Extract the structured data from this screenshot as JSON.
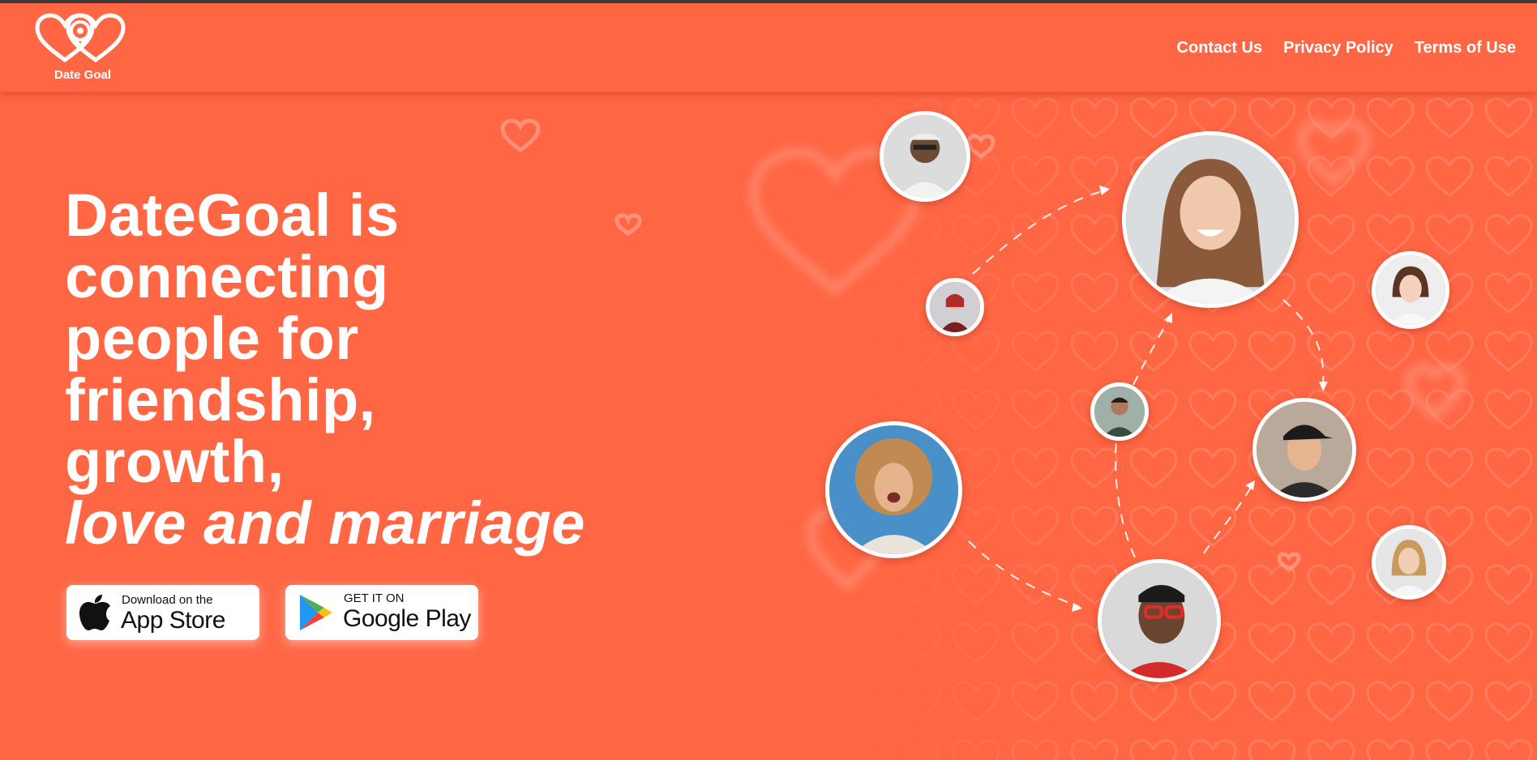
{
  "brand": {
    "name": "Date Goal",
    "accent_color": "#ff6644"
  },
  "nav": {
    "items": [
      {
        "label": "Contact Us"
      },
      {
        "label": "Privacy Policy"
      },
      {
        "label": "Terms of Use"
      }
    ]
  },
  "hero": {
    "lines": [
      "DateGoal is",
      "connecting",
      "people for",
      "friendship,",
      "growth,"
    ],
    "italic_line": "love and marriage"
  },
  "app_store": {
    "small": "Download on the",
    "big": "App Store",
    "icon": "apple-icon"
  },
  "google_play": {
    "small": "GET IT ON",
    "big": "Google Play",
    "icon": "google-play-icon"
  },
  "avatars": [
    {
      "name": "avatar-man-glasses"
    },
    {
      "name": "avatar-woman-red-scarf"
    },
    {
      "name": "avatar-woman-smiling-large"
    },
    {
      "name": "avatar-woman-hand-chin"
    },
    {
      "name": "avatar-man-small"
    },
    {
      "name": "avatar-man-cap"
    },
    {
      "name": "avatar-woman-curly-hair"
    },
    {
      "name": "avatar-man-red-glasses"
    },
    {
      "name": "avatar-woman-blonde"
    }
  ]
}
